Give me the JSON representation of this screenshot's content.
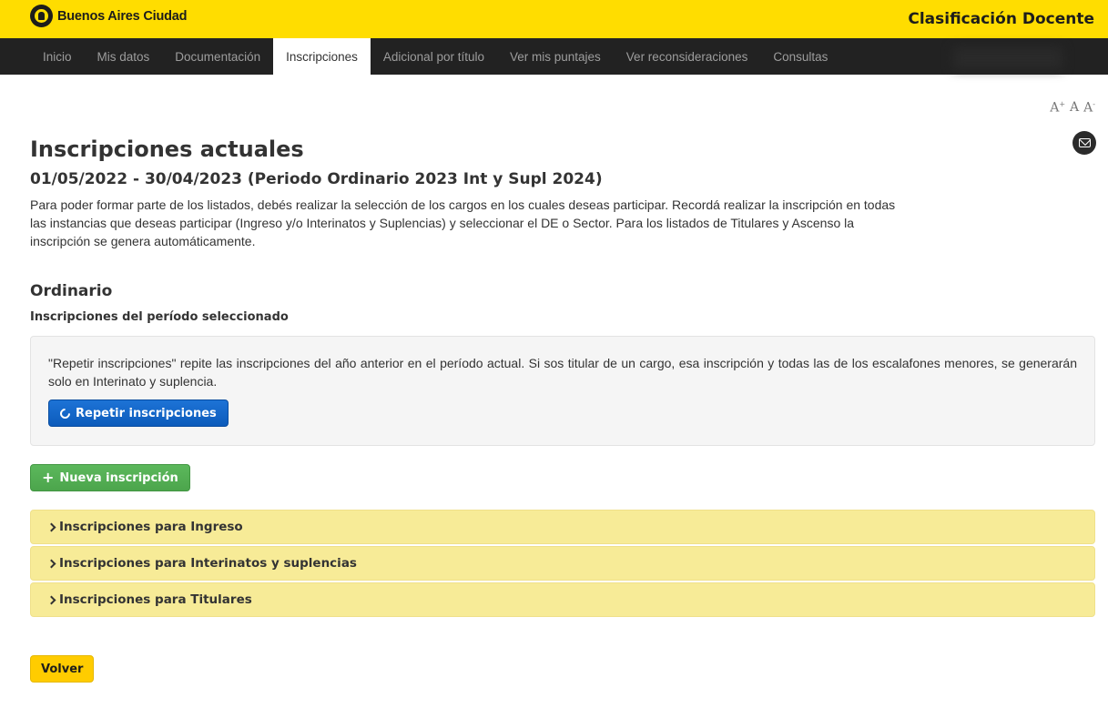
{
  "header": {
    "brand": "Buenos Aires Ciudad",
    "app_title": "Clasificación Docente"
  },
  "nav": {
    "items": [
      {
        "label": "Inicio",
        "active": false
      },
      {
        "label": "Mis datos",
        "active": false
      },
      {
        "label": "Documentación",
        "active": false
      },
      {
        "label": "Inscripciones",
        "active": true
      },
      {
        "label": "Adicional por título",
        "active": false
      },
      {
        "label": "Ver mis puntajes",
        "active": false
      },
      {
        "label": "Ver reconsideraciones",
        "active": false
      },
      {
        "label": "Consultas",
        "active": false
      }
    ]
  },
  "tools": {
    "font_increase": "A",
    "font_increase_sup": "+",
    "font_normal": "A",
    "font_decrease": "A",
    "font_decrease_sup": "-",
    "mail_icon": "envelope-icon"
  },
  "main": {
    "title": "Inscripciones actuales",
    "period": "01/05/2022 - 30/04/2023 (Periodo Ordinario 2023 Int y Supl 2024)",
    "intro": "Para poder formar parte de los listados, debés realizar la selección de los cargos en los cuales deseas participar. Recordá realizar la inscripción en todas las instancias que deseas participar (Ingreso y/o Interinatos y Suplencias) y seleccionar el DE o Sector. Para los listados de Titulares y Ascenso la inscripción se genera automáticamente.",
    "section_title": "Ordinario",
    "subsection_title": "Inscripciones del período seleccionado",
    "repeat_info": "\"Repetir inscripciones\" repite las inscripciones del año anterior en el período actual. Si sos titular de un cargo, esa inscripción y todas las de los escalafones menores, se generarán solo en Interinato y suplencia.",
    "repeat_button": "Repetir inscripciones",
    "new_button": "Nueva inscripción",
    "panels": [
      {
        "label": "Inscripciones para Ingreso"
      },
      {
        "label": "Inscripciones para Interinatos y suplencias"
      },
      {
        "label": "Inscripciones para Titulares"
      }
    ],
    "back_button": "Volver"
  },
  "colors": {
    "brand_yellow": "#ffdd00",
    "nav_dark": "#222222",
    "panel_yellow": "#f7eb97",
    "primary_blue": "#0c5bbb",
    "success_green": "#5cb85c"
  }
}
